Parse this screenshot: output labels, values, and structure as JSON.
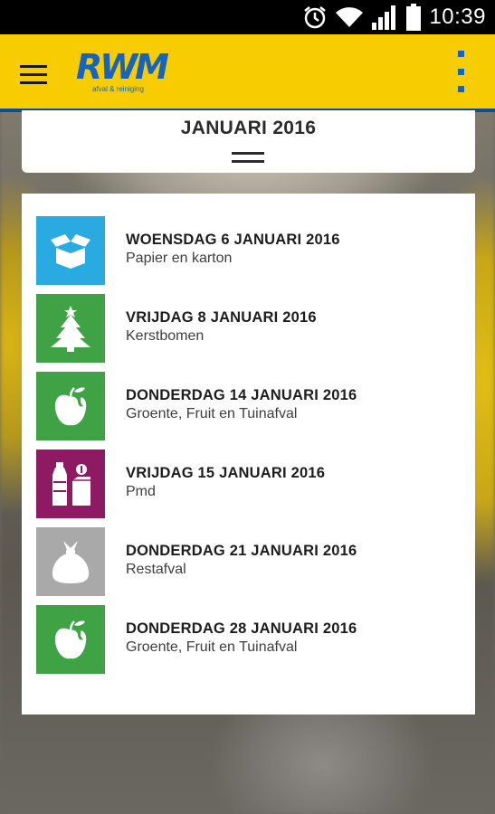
{
  "status_bar": {
    "time": "10:39",
    "icons": [
      "alarm-icon",
      "wifi-icon",
      "signal-icon",
      "battery-icon"
    ]
  },
  "app_bar": {
    "logo": "RWM",
    "logo_sub": "afval & reiniging",
    "menu_icon": "hamburger-menu-icon",
    "overflow_icon": "overflow-menu-icon",
    "background_color": "#f7cc00",
    "accent_color": "#1565c0"
  },
  "month": {
    "title": "JANUARI 2016"
  },
  "pickups": [
    {
      "date": "WOENSDAG 6 JANUARI 2016",
      "type": "Papier en karton",
      "icon": "open-box-icon",
      "color": "#29abe2"
    },
    {
      "date": "VRIJDAG 8 JANUARI 2016",
      "type": "Kerstbomen",
      "icon": "christmas-tree-icon",
      "color": "#3fa346"
    },
    {
      "date": "DONDERDAG 14 JANUARI 2016",
      "type": "Groente, Fruit en Tuinafval",
      "icon": "apple-icon",
      "color": "#3fa346"
    },
    {
      "date": "VRIJDAG 15 JANUARI 2016",
      "type": "Pmd",
      "icon": "bottle-and-carton-icon",
      "color": "#8d1a63"
    },
    {
      "date": "DONDERDAG 21 JANUARI 2016",
      "type": "Restafval",
      "icon": "garbage-bag-icon",
      "color": "#a9a9a9"
    },
    {
      "date": "DONDERDAG 28 JANUARI 2016",
      "type": "Groente, Fruit en Tuinafval",
      "icon": "apple-icon",
      "color": "#3fa346"
    }
  ]
}
